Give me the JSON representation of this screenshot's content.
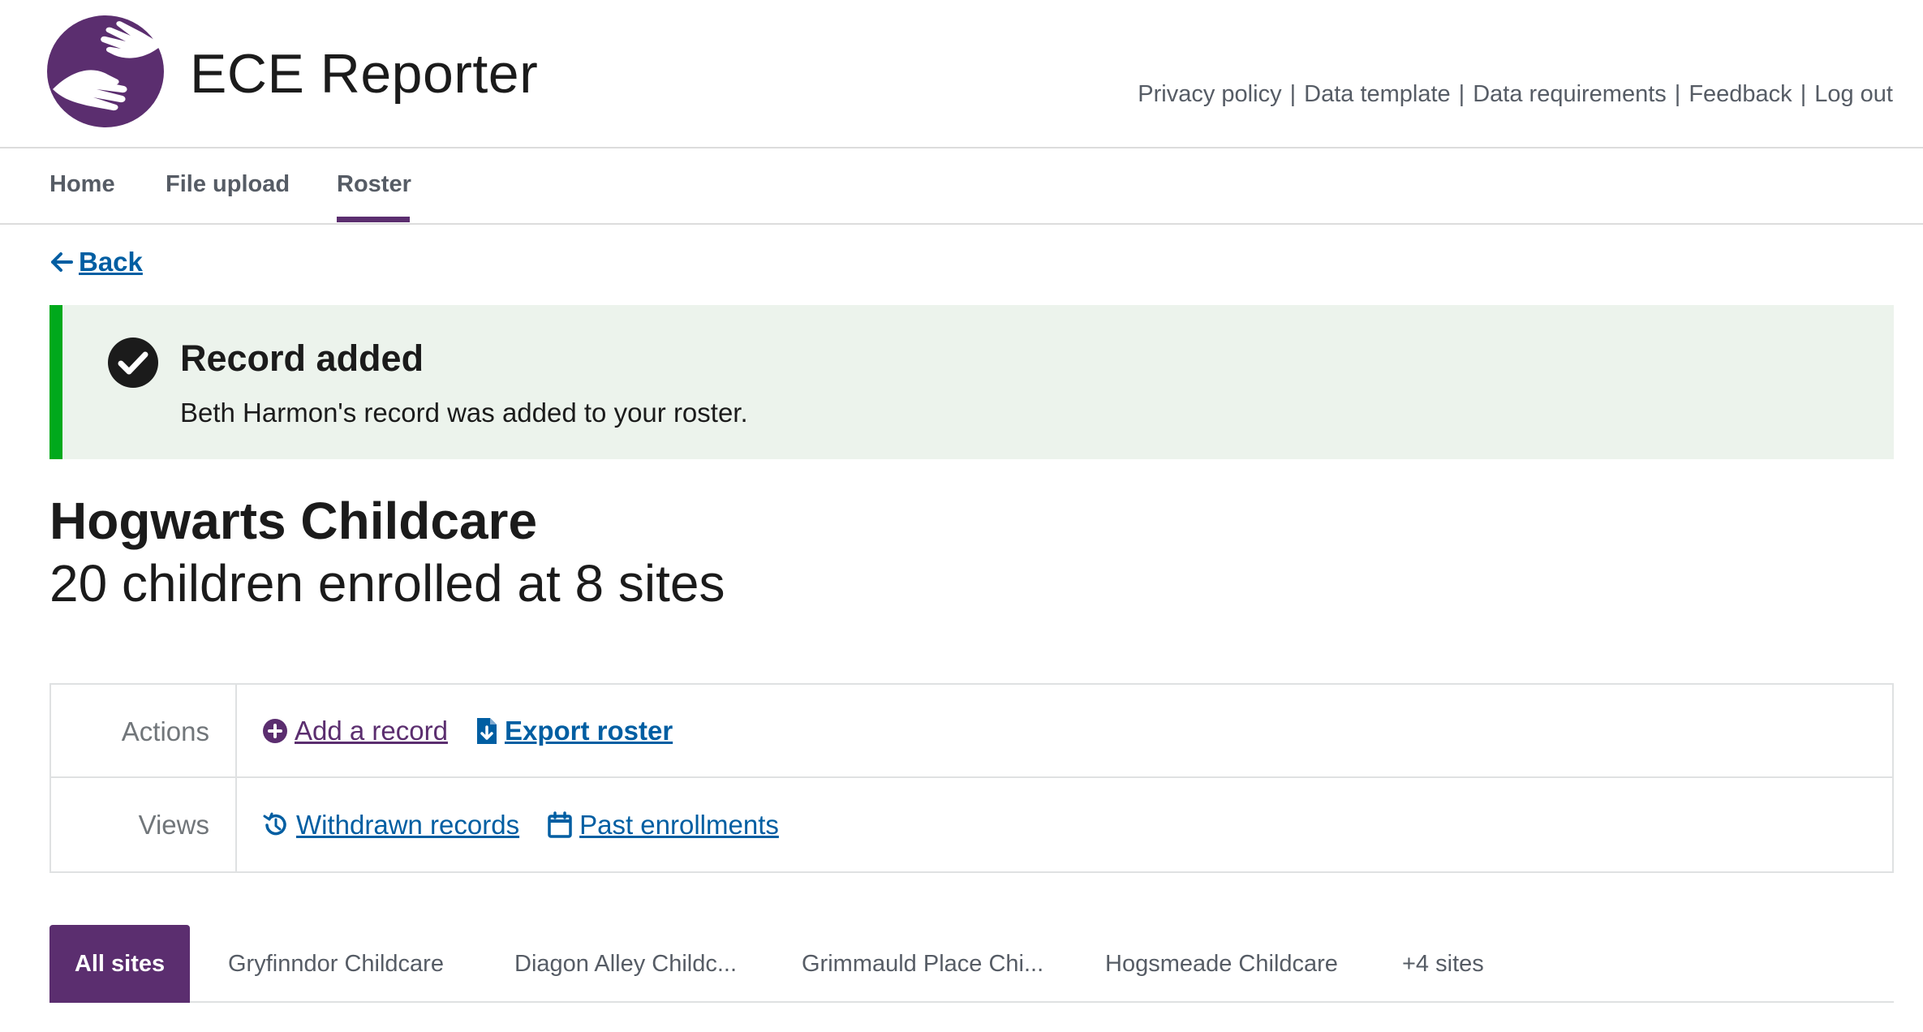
{
  "header": {
    "app_title": "ECE Reporter",
    "links": [
      {
        "label": "Privacy policy",
        "name": "privacy-policy-link"
      },
      {
        "label": "Data template",
        "name": "data-template-link"
      },
      {
        "label": "Data requirements",
        "name": "data-requirements-link"
      },
      {
        "label": "Feedback",
        "name": "feedback-link"
      },
      {
        "label": "Log out",
        "name": "log-out-link"
      }
    ]
  },
  "nav": {
    "home": "Home",
    "file_upload": "File upload",
    "roster": "Roster",
    "active": "Roster"
  },
  "back_label": "Back",
  "alert": {
    "heading": "Record added",
    "body": "Beth Harmon's record was added to your roster."
  },
  "organization": {
    "name": "Hogwarts Childcare",
    "summary": "20 children enrolled at 8 sites"
  },
  "actions": {
    "label": "Actions",
    "add_record": "Add a record",
    "export_roster": "Export roster"
  },
  "views": {
    "label": "Views",
    "withdrawn_records": "Withdrawn records",
    "past_enrollments": "Past enrollments"
  },
  "site_tabs": {
    "all_sites": "All sites",
    "tab1": "Gryfinndor Childcare",
    "tab2": "Diagon Alley Childc...",
    "tab3": "Grimmauld Place Chi...",
    "tab4": "Hogsmeade Childcare",
    "more": "+4 sites"
  },
  "colors": {
    "brand_purple": "#5b2e6f",
    "link_blue": "#005ea2",
    "success_green": "#00a91c",
    "alert_bg": "#ecf3ec"
  }
}
